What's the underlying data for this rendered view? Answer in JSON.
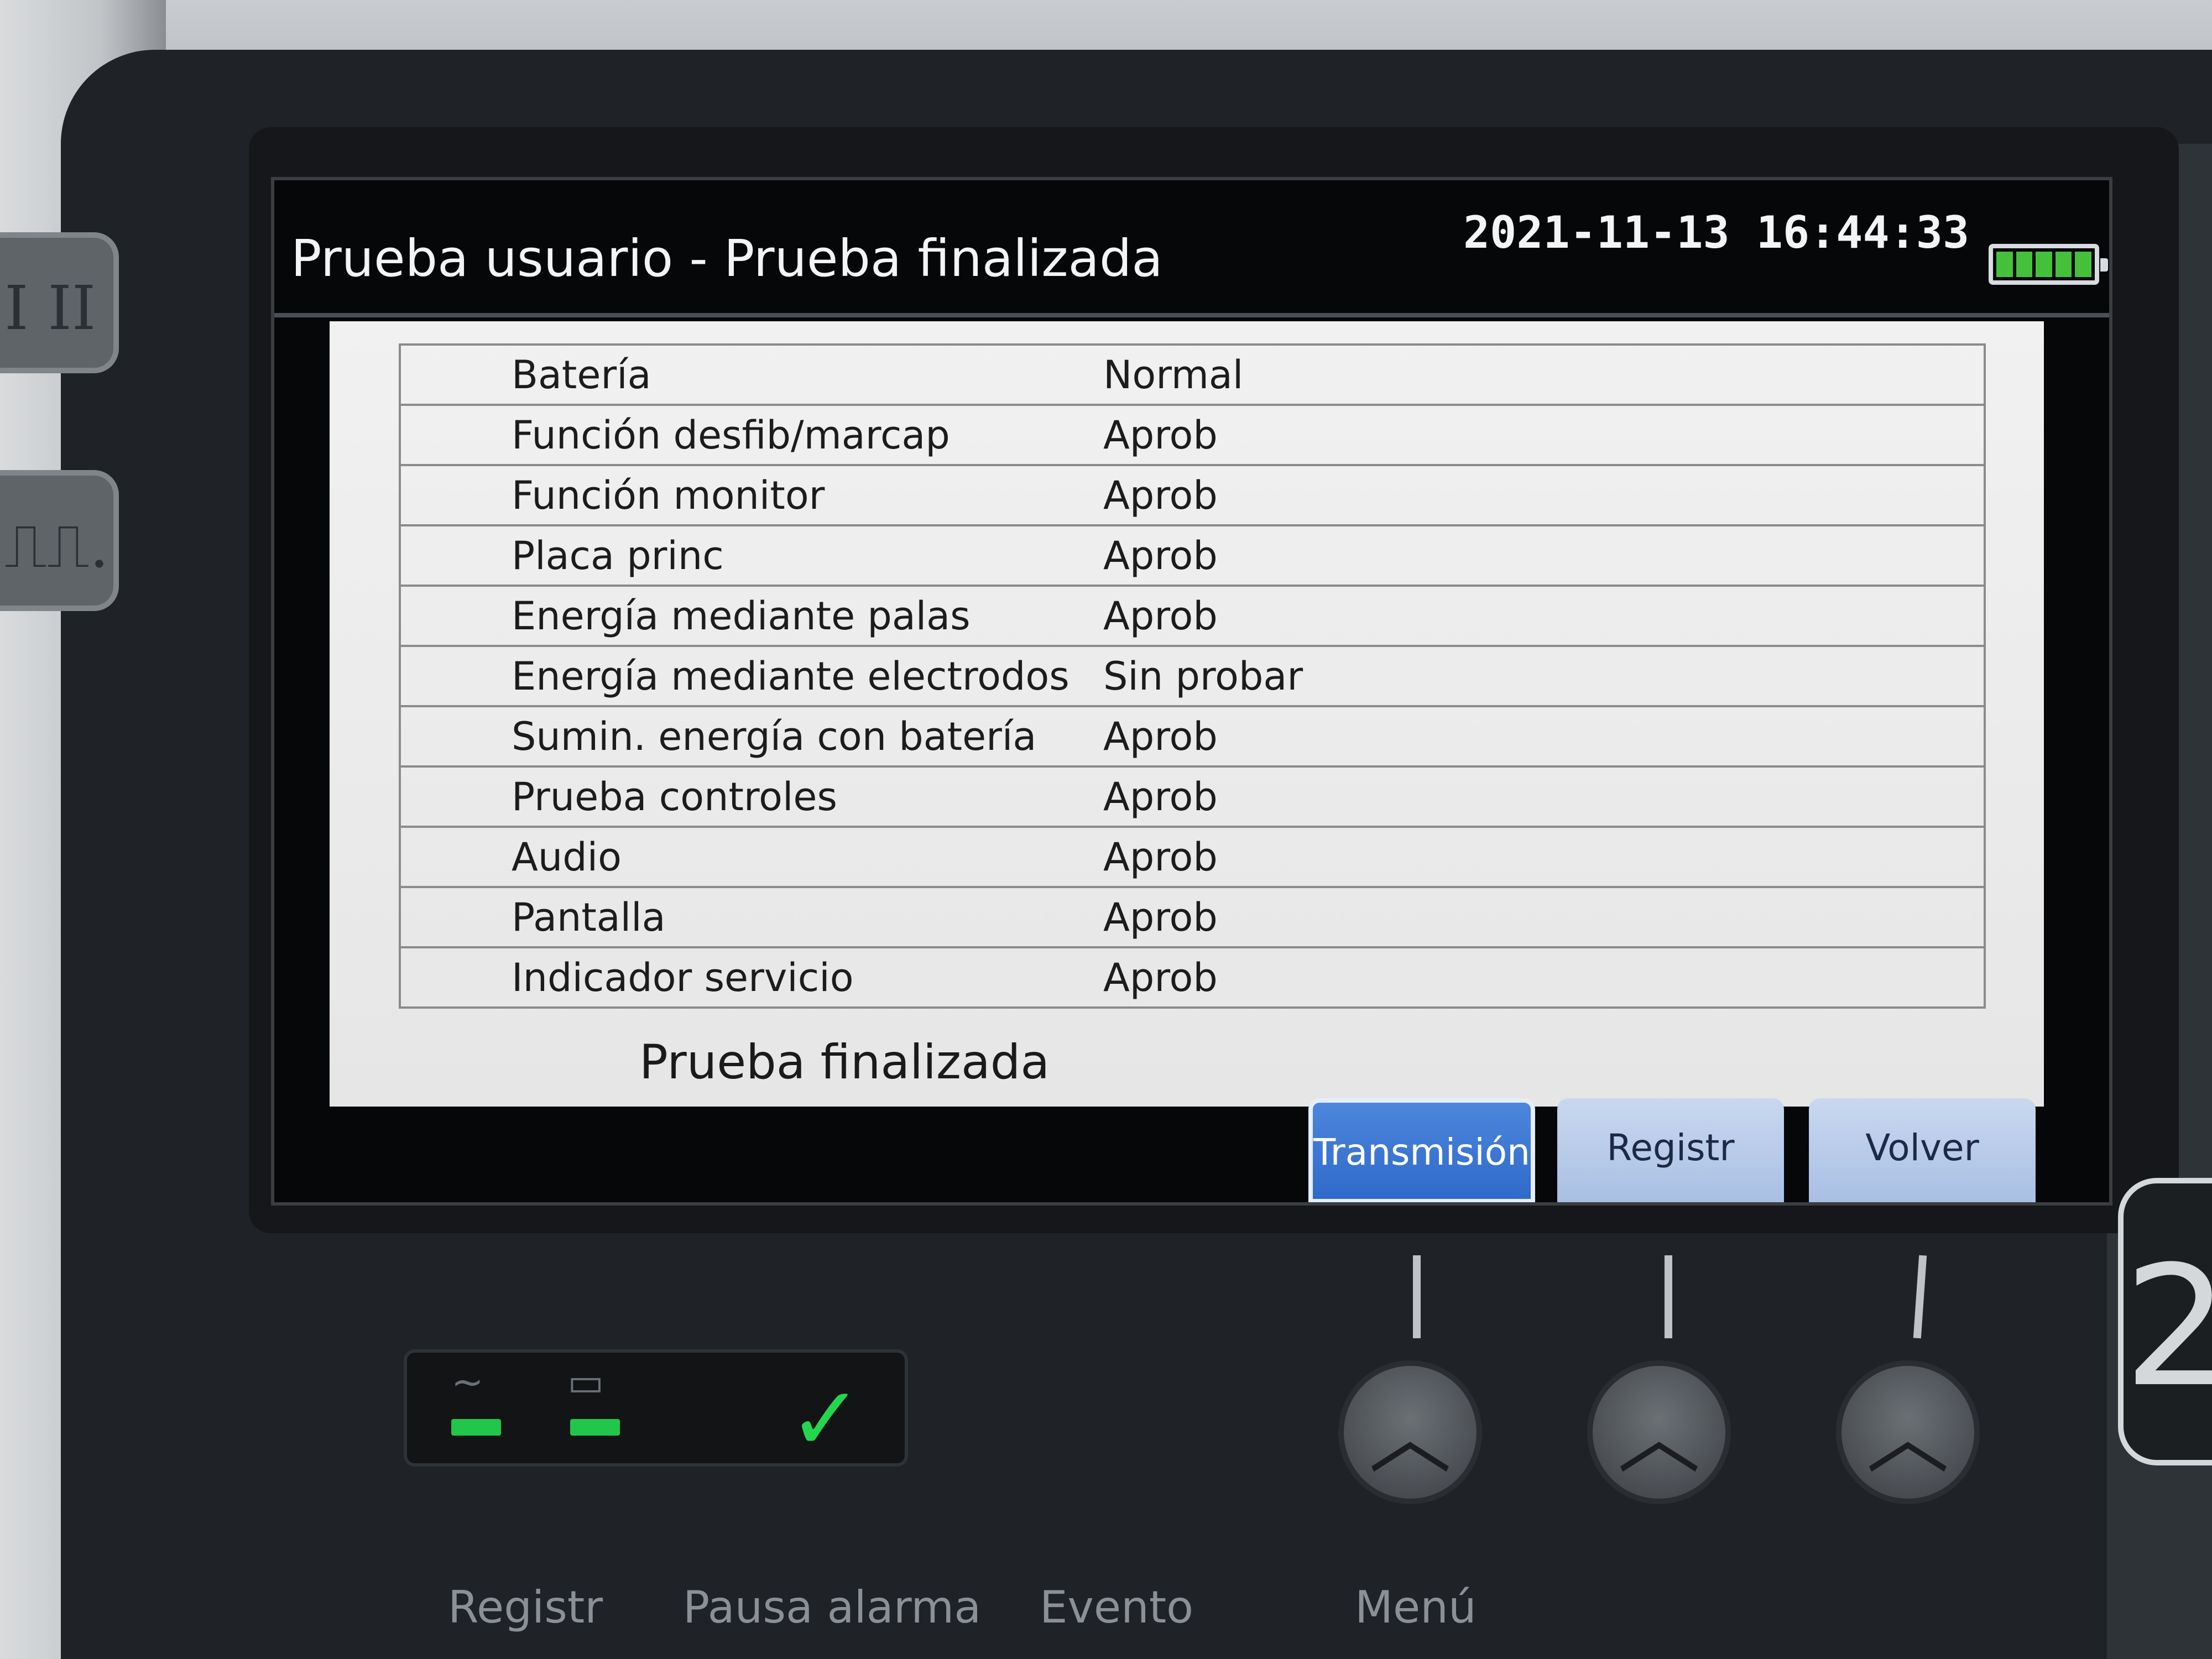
{
  "header": {
    "title": "Prueba usuario - Prueba finalizada",
    "datetime": "2021-11-13 16:44:33",
    "battery_icon": "battery-full-icon",
    "battery_color": "#45c03a"
  },
  "results": [
    {
      "label": "Batería",
      "value": "Normal"
    },
    {
      "label": "Función desfib/marcap",
      "value": "Aprob"
    },
    {
      "label": "Función monitor",
      "value": "Aprob"
    },
    {
      "label": "Placa princ",
      "value": "Aprob"
    },
    {
      "label": "Energía mediante palas",
      "value": "Aprob"
    },
    {
      "label": "Energía mediante electrodos",
      "value": "Sin probar"
    },
    {
      "label": "Sumin. energía con batería",
      "value": "Aprob"
    },
    {
      "label": "Prueba controles",
      "value": "Aprob"
    },
    {
      "label": "Audio",
      "value": "Aprob"
    },
    {
      "label": "Pantalla",
      "value": "Aprob"
    },
    {
      "label": "Indicador servicio",
      "value": "Aprob"
    }
  ],
  "status_text": "Prueba finalizada",
  "softkeys": {
    "transmision": "Transmisión",
    "registr": "Registr",
    "volver": "Volver",
    "active_color": "#2f6acb"
  },
  "side_keys": {
    "lead_label": "I II ...",
    "pacer_label": "⎍⎍..."
  },
  "right_key_label": "2",
  "indicators": {
    "ac_icon": "ac-power-icon",
    "battery_icon": "battery-icon",
    "check_icon": "check-icon",
    "led_color": "#21c74a"
  },
  "hard_keys": {
    "registr": "Registr",
    "pausa_alarma": "Pausa alarma",
    "evento": "Evento",
    "menu": "Menú"
  }
}
